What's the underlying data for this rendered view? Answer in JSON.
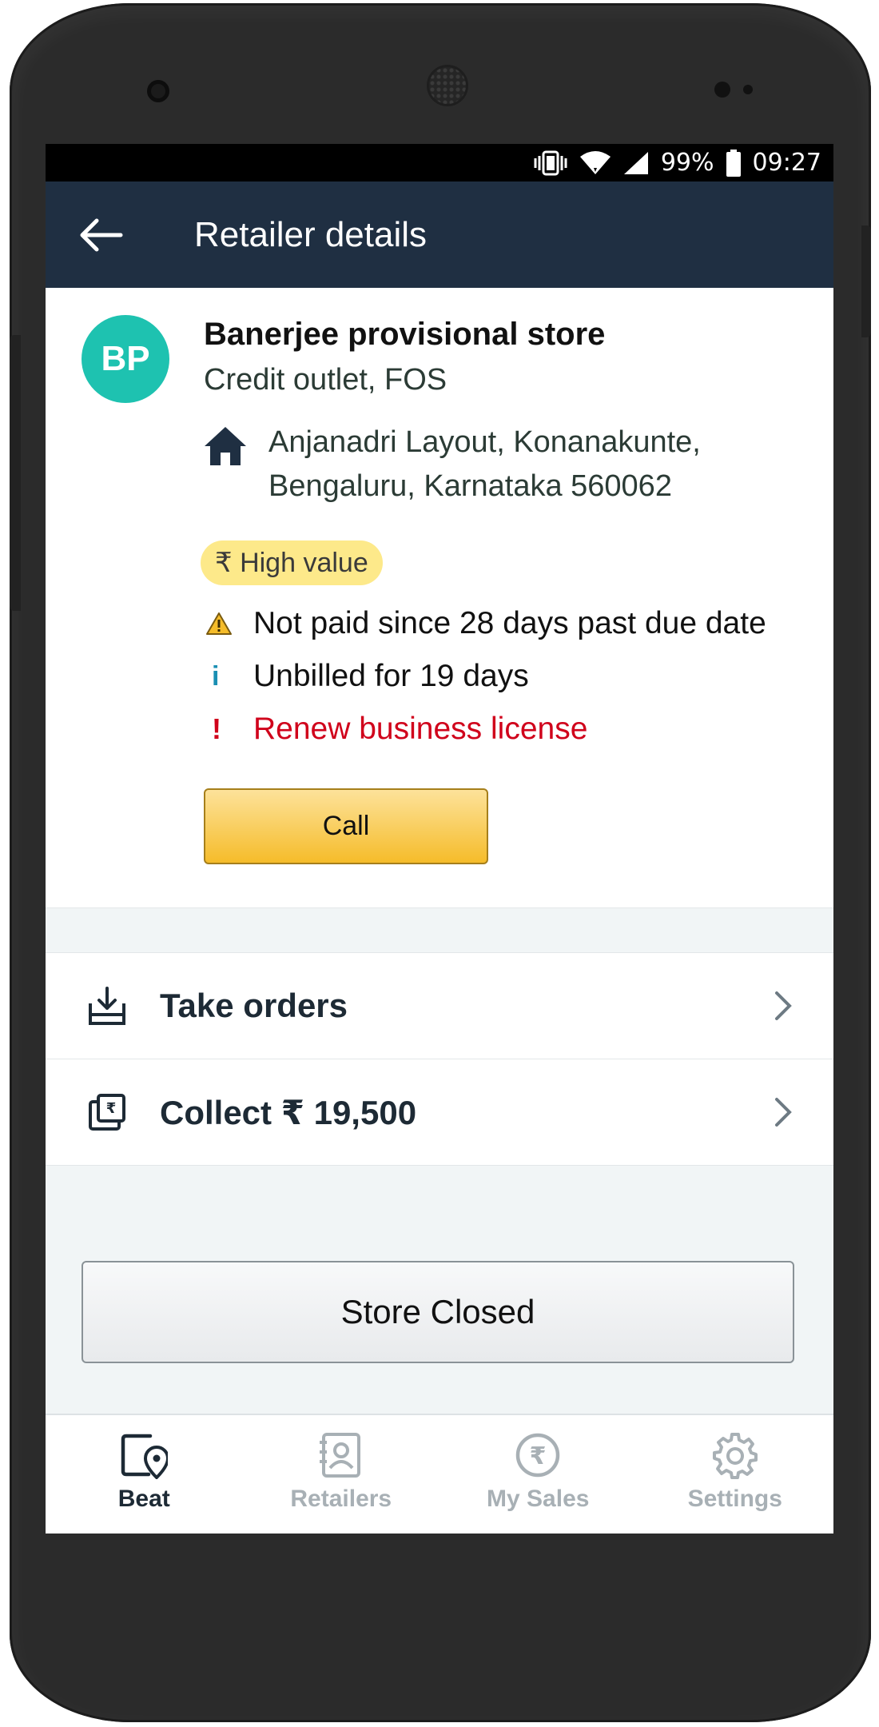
{
  "status_bar": {
    "battery": "99%",
    "time": "09:27"
  },
  "app_bar": {
    "title": "Retailer details"
  },
  "retailer": {
    "initials": "BP",
    "name": "Banerjee provisional store",
    "type": "Credit outlet, FOS",
    "address_line1": "Anjanadri Layout, Konanakunte,",
    "address_line2": "Bengaluru, Karnataka 560062",
    "badge": "₹ High value",
    "alerts": [
      {
        "icon": "warning-icon",
        "text": "Not paid since 28 days past due date"
      },
      {
        "icon": "info-icon",
        "text": "Unbilled for 19 days"
      },
      {
        "icon": "exclamation-icon",
        "text": "Renew business license"
      }
    ],
    "call_label": "Call"
  },
  "actions": [
    {
      "icon": "download-tray-icon",
      "label": "Take orders"
    },
    {
      "icon": "rupee-document-icon",
      "label": "Collect ₹ 19,500"
    }
  ],
  "store_closed_label": "Store Closed",
  "bottom_nav": [
    {
      "icon": "beat-location-icon",
      "label": "Beat",
      "active": true
    },
    {
      "icon": "retailers-contact-icon",
      "label": "Retailers",
      "active": false
    },
    {
      "icon": "rupee-circle-icon",
      "label": "My Sales",
      "active": false
    },
    {
      "icon": "gear-icon",
      "label": "Settings",
      "active": false
    }
  ],
  "colors": {
    "app_bar": "#1f2f42",
    "avatar": "#1ec2b0",
    "badge": "#fde98a",
    "alert_red": "#d0021b",
    "info_blue": "#1a8fb3",
    "call_button": "#f5bc2a"
  }
}
